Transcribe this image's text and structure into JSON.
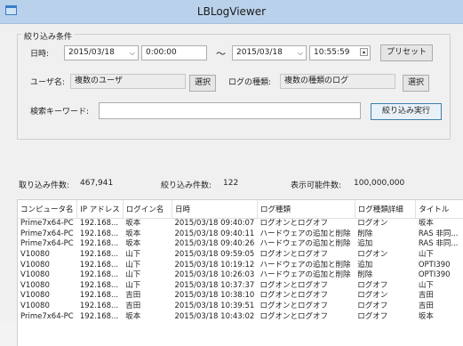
{
  "window": {
    "title": "LBLogViewer"
  },
  "filter": {
    "legend": "絞り込み条件",
    "date_label": "日時:",
    "date_from": "2015/03/18",
    "time_from": "0:00:00",
    "range_sep": "〜",
    "date_to": "2015/03/18",
    "time_to": "10:55:59",
    "preset_label": "プリセット",
    "user_label": "ユーザ名:",
    "user_value": "複数のユーザ",
    "user_select_label": "選択",
    "logtype_label": "ログの種類:",
    "logtype_value": "複数の種類のログ",
    "logtype_select_label": "選択",
    "keyword_label": "検索キーワード:",
    "keyword_value": "",
    "run_label": "絞り込み実行"
  },
  "stats": {
    "loaded_label": "取り込み件数:",
    "loaded_value": "467,941",
    "filtered_label": "絞り込み件数:",
    "filtered_value": "122",
    "max_label": "表示可能件数:",
    "max_value": "100,000,000"
  },
  "grid": {
    "columns": [
      "コンピュータ名",
      "IP アドレス",
      "ログイン名",
      "日時",
      "ログ種類",
      "ログ種類詳細",
      "タイトル"
    ],
    "rows": [
      [
        "Prime7x64-PC",
        "192.168...",
        "坂本",
        "2015/03/18 09:40:07",
        "ログオンとログオフ",
        "ログオン",
        "坂本"
      ],
      [
        "Prime7x64-PC",
        "192.168...",
        "坂本",
        "2015/03/18 09:40:11",
        "ハードウェアの追加と削除",
        "削除",
        "RAS 非同..."
      ],
      [
        "Prime7x64-PC",
        "192.168...",
        "坂本",
        "2015/03/18 09:40:26",
        "ハードウェアの追加と削除",
        "追加",
        "RAS 非同..."
      ],
      [
        "V10080",
        "192.168...",
        "山下",
        "2015/03/18 09:59:05",
        "ログオンとログオフ",
        "ログオン",
        "山下"
      ],
      [
        "V10080",
        "192.168...",
        "山下",
        "2015/03/18 10:19:12",
        "ハードウェアの追加と削除",
        "追加",
        "OPTI390"
      ],
      [
        "V10080",
        "192.168...",
        "山下",
        "2015/03/18 10:26:03",
        "ハードウェアの追加と削除",
        "削除",
        "OPTI390"
      ],
      [
        "V10080",
        "192.168...",
        "山下",
        "2015/03/18 10:37:37",
        "ログオンとログオフ",
        "ログオフ",
        "山下"
      ],
      [
        "V10080",
        "192.168...",
        "吉田",
        "2015/03/18 10:38:10",
        "ログオンとログオフ",
        "ログオン",
        "吉田"
      ],
      [
        "V10080",
        "192.168...",
        "吉田",
        "2015/03/18 10:39:51",
        "ログオンとログオフ",
        "ログオフ",
        "吉田"
      ],
      [
        "Prime7x64-PC",
        "192.168...",
        "坂本",
        "2015/03/18 10:43:02",
        "ログオンとログオフ",
        "ログオフ",
        "坂本"
      ]
    ]
  }
}
